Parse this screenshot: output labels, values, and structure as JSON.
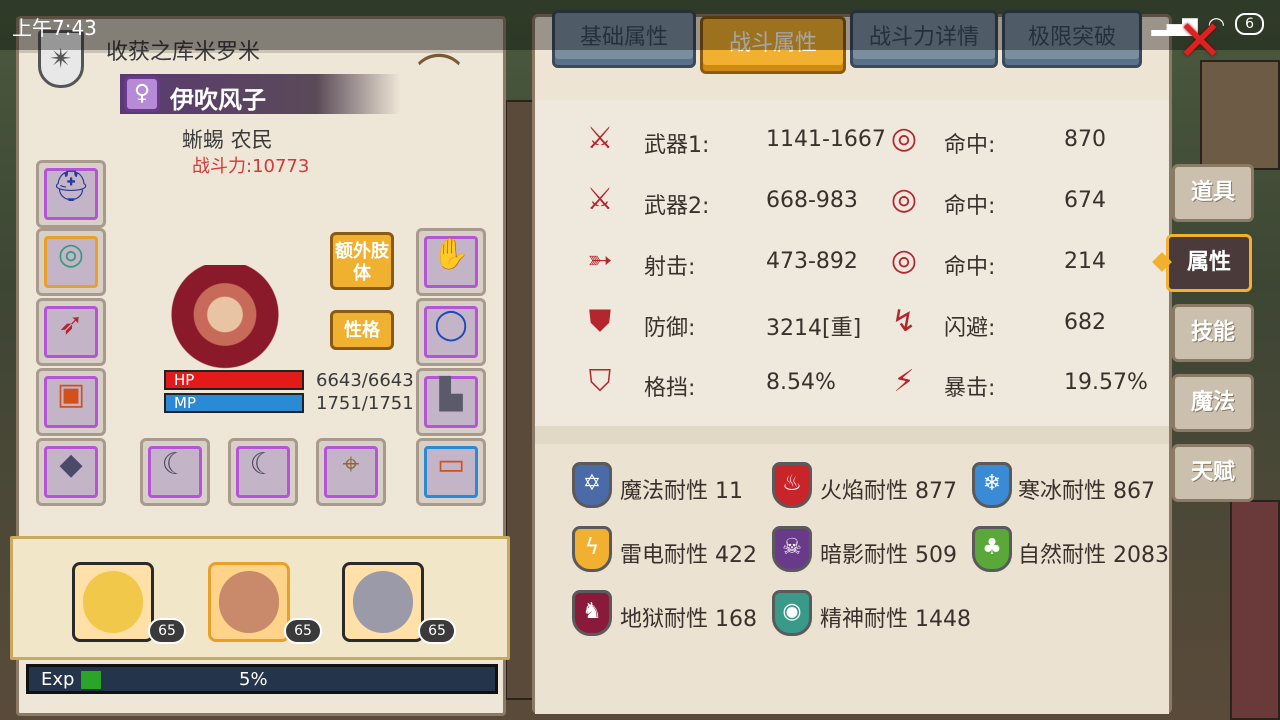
{
  "status_bar": {
    "time": "上午7:43",
    "battery": "6",
    "signal_icon": "signal-icon",
    "wifi_icon": "wifi-icon"
  },
  "character": {
    "title": "收获之库米罗米",
    "name": "伊吹风子",
    "race_job": "蜥蜴 农民",
    "power": "战斗力:10773",
    "hp_label": "HP",
    "mp_label": "MP",
    "hp": "6643/6643",
    "mp": "1751/1751",
    "hp_fraction": 1.0,
    "mp_fraction": 1.0
  },
  "left_buttons": {
    "extra_limb": "额外肢体",
    "personality": "性格"
  },
  "party": [
    {
      "level": "65"
    },
    {
      "level": "65"
    },
    {
      "level": "65"
    }
  ],
  "exp": {
    "label": "Exp",
    "percent": "5%",
    "fraction": 0.05
  },
  "tabs": [
    "基础属性",
    "战斗属性",
    "战斗力详情",
    "极限突破"
  ],
  "active_tab": 1,
  "combat_stats": {
    "left": [
      {
        "label": "武器1:",
        "value": "1141-1667",
        "icon": "sword-icon"
      },
      {
        "label": "武器2:",
        "value": "668-983",
        "icon": "sword-icon"
      },
      {
        "label": "射击:",
        "value": "473-892",
        "icon": "bow-icon"
      },
      {
        "label": "防御:",
        "value": "3214[重]",
        "icon": "shield-icon"
      },
      {
        "label": "格挡:",
        "value": "8.54%",
        "icon": "block-icon"
      }
    ],
    "right": [
      {
        "label": "命中:",
        "value": "870",
        "icon": "target-icon"
      },
      {
        "label": "命中:",
        "value": "674",
        "icon": "target-icon"
      },
      {
        "label": "命中:",
        "value": "214",
        "icon": "target-icon"
      },
      {
        "label": "闪避:",
        "value": "682",
        "icon": "dodge-icon"
      },
      {
        "label": "暴击:",
        "value": "19.57%",
        "icon": "crit-icon"
      }
    ]
  },
  "resistances": [
    {
      "text": "魔法耐性 11",
      "icon": "magic-resist-icon",
      "color": "#4a6aa8"
    },
    {
      "text": "火焰耐性 877",
      "icon": "fire-resist-icon",
      "color": "#c8242a"
    },
    {
      "text": "寒冰耐性 867",
      "icon": "ice-resist-icon",
      "color": "#3a8ad6"
    },
    {
      "text": "雷电耐性 422",
      "icon": "lightning-resist-icon",
      "color": "#f2b030"
    },
    {
      "text": "暗影耐性 509",
      "icon": "shadow-resist-icon",
      "color": "#6a3a8a"
    },
    {
      "text": "自然耐性 2083",
      "icon": "nature-resist-icon",
      "color": "#5aa83a"
    },
    {
      "text": "地狱耐性 168",
      "icon": "hell-resist-icon",
      "color": "#8a1a3a"
    },
    {
      "text": "精神耐性 1448",
      "icon": "spirit-resist-icon",
      "color": "#3a9a8a"
    }
  ],
  "side_tabs": [
    "道具",
    "属性",
    "技能",
    "魔法",
    "天赋"
  ],
  "active_side_tab": 1
}
